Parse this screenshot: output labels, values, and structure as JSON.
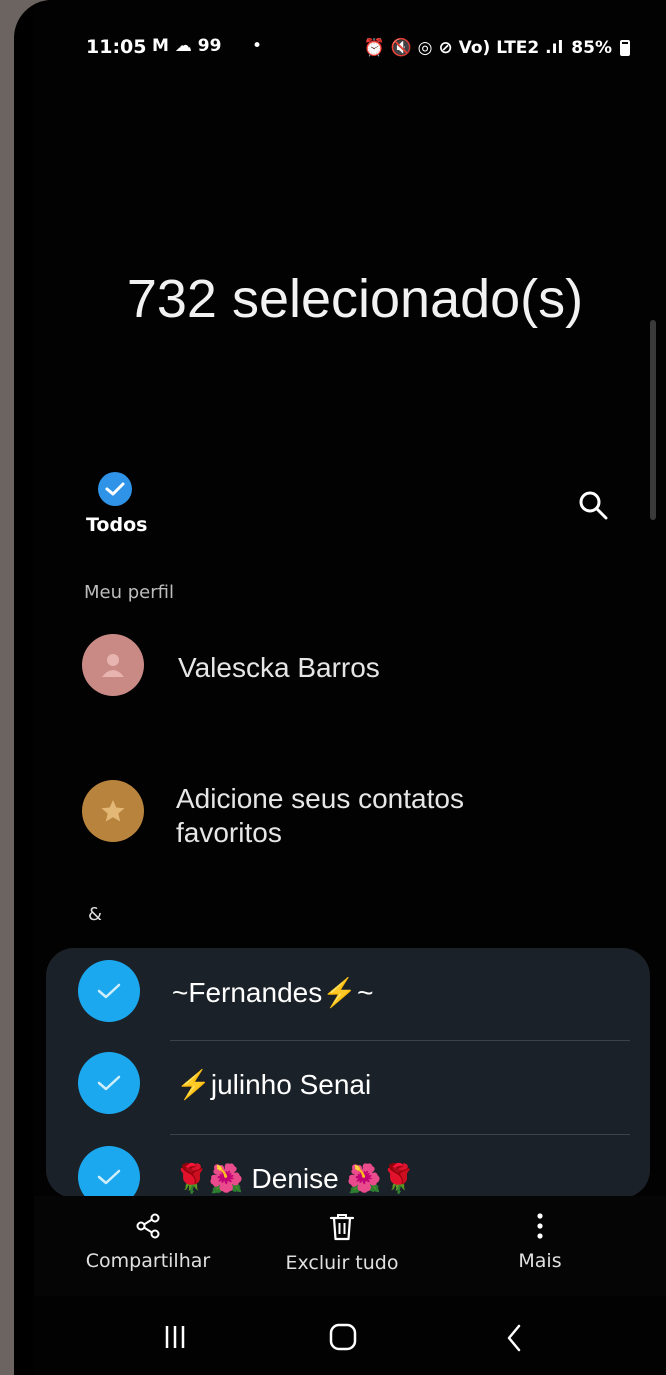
{
  "status_bar": {
    "time": "11:05",
    "left_icons": "M ☁ 99",
    "dot": "•",
    "right_icons": "⏰ 🔇 ◎ ⊘ Vo) LTE2 .ıl",
    "battery": "85%"
  },
  "header": {
    "selected_count_title": "732 selecionado(s)"
  },
  "toolbar": {
    "select_all_label": "Todos"
  },
  "profile": {
    "section_label": "Meu perfil",
    "name": "Valescka Barros",
    "avatar_color": "#c98a86"
  },
  "favorites": {
    "line1": "Adicione seus contatos",
    "line2": "favoritos",
    "avatar_color": "#b8833c"
  },
  "contacts_section": {
    "index_label": "&",
    "items": [
      {
        "name": "~Fernandes⚡~"
      },
      {
        "name": "⚡julinho Senai"
      },
      {
        "name": "🌹🌺 Denise 🌺🌹"
      }
    ]
  },
  "bottom_actions": {
    "share_label": "Compartilhar",
    "delete_all_label": "Excluir tudo",
    "more_label": "Mais"
  },
  "colors": {
    "accent": "#1ba8ee",
    "select_all_check": "#2f93e8",
    "panel": "#1b2128"
  }
}
